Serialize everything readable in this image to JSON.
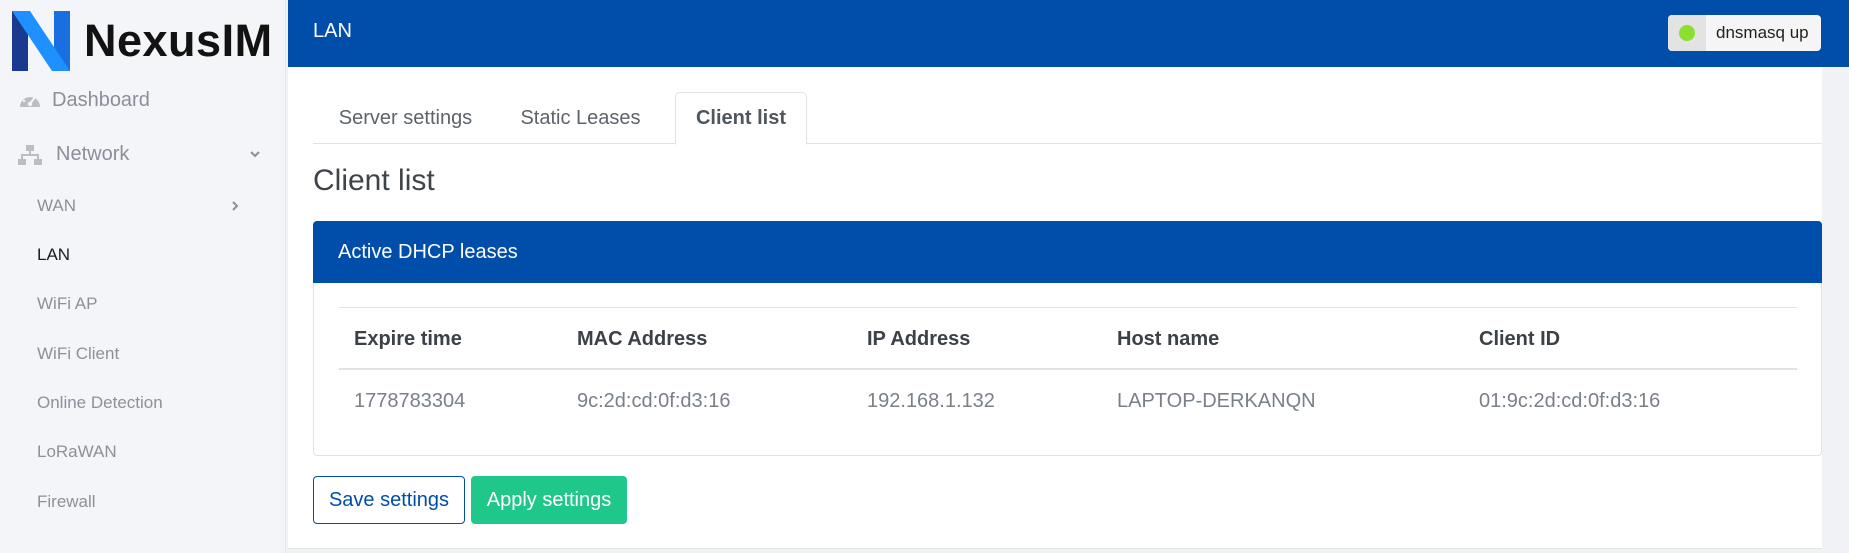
{
  "brand": {
    "name": "NexusIM",
    "colors": {
      "primary": "#004eaa",
      "logo_dark": "#1a3a8f",
      "logo_light": "#1e90ff"
    }
  },
  "sidebar": {
    "items": [
      {
        "label": "Dashboard",
        "icon": "speedometer-icon"
      },
      {
        "label": "Network",
        "icon": "network-icon",
        "expanded": true
      },
      {
        "label": "WAN",
        "icon": "chevron-right-icon"
      },
      {
        "label": "LAN",
        "active": true
      },
      {
        "label": "WiFi AP"
      },
      {
        "label": "WiFi Client"
      },
      {
        "label": "Online Detection"
      },
      {
        "label": "LoRaWAN"
      },
      {
        "label": "Firewall"
      }
    ]
  },
  "header": {
    "title": "LAN",
    "status": {
      "label": "dnsmasq up",
      "color": "#8cde2f"
    }
  },
  "tabs": [
    {
      "label": "Server settings",
      "active": false
    },
    {
      "label": "Static Leases",
      "active": false
    },
    {
      "label": "Client list",
      "active": true
    }
  ],
  "section_title": "Client list",
  "panel": {
    "title": "Active DHCP leases",
    "columns": [
      "Expire time",
      "MAC Address",
      "IP Address",
      "Host name",
      "Client ID"
    ],
    "rows": [
      [
        "1778783304",
        "9c:2d:cd:0f:d3:16",
        "192.168.1.132",
        "LAPTOP-DERKANQN",
        "01:9c:2d:cd:0f:d3:16"
      ]
    ]
  },
  "buttons": {
    "save": "Save settings",
    "apply": "Apply settings",
    "apply_color": "#1fc78a"
  }
}
